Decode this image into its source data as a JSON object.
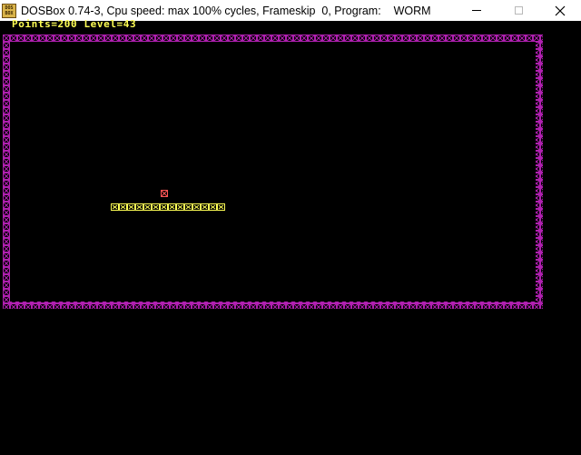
{
  "window": {
    "title": "DOSBox 0.74-3, Cpu speed: max 100% cycles, Frameskip  0, Program:    WORM",
    "icon": "dosbox-icon",
    "icon_text_top": "DOS",
    "icon_text_bottom": "BOX",
    "buttons": [
      "minimize",
      "maximize",
      "close"
    ],
    "close_glyph": "✕"
  },
  "game": {
    "hud_text": "Points=200 Level=43",
    "points": 200,
    "level": 43,
    "colors": {
      "hud": "#ffff55",
      "border": "#b020b0",
      "worm": "#ffff55",
      "food": "#ff5555",
      "background": "#000000"
    },
    "worm_length": 14
  }
}
